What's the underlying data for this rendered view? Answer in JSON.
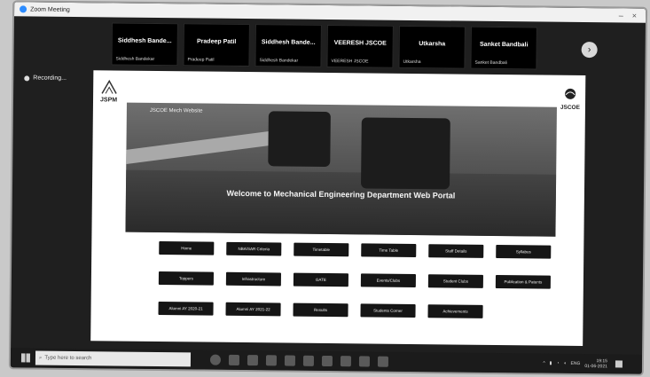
{
  "window": {
    "title": "Zoom Meeting"
  },
  "participants": [
    {
      "name": "Siddhesh Bande...",
      "sub": "Siddhesh Bandekar"
    },
    {
      "name": "Pradeep Patil",
      "sub": "Pradeep Patil"
    },
    {
      "name": "Siddhesh Bande...",
      "sub": "Siddhesh Bandekar"
    },
    {
      "name": "VEERESH JSCOE",
      "sub": "VEERESH JSCOE"
    },
    {
      "name": "Utkarsha",
      "sub": "Utkarsha"
    },
    {
      "name": "Sanket Bandbali",
      "sub": "Sanket Bandbali"
    }
  ],
  "recording": {
    "label": "Recording..."
  },
  "share": {
    "left_logo": "JSPM",
    "right_logo": "JSCOE",
    "banner_header": "JSCOE Mech Website",
    "welcome_text": "Welcome to Mechanical Engineering Department Web Portal",
    "nav_rows": [
      [
        "Home",
        "NBA/SAR Criteria",
        "Timetable",
        "Time Table",
        "Staff Details",
        "Syllabus"
      ],
      [
        "Toppers",
        "Infrastructure",
        "GATE",
        "Events/Clubs",
        "Student Clubs",
        "Publication & Patents"
      ],
      [
        "Alumni AY 2020-21",
        "Alumni AY 2021-22",
        "Results",
        "Students Corner",
        "Achievements"
      ]
    ]
  },
  "taskbar": {
    "search_placeholder": "Type here to search",
    "clock_time": "19:15",
    "clock_date": "01-06-2021",
    "tray_text": "ENG"
  }
}
